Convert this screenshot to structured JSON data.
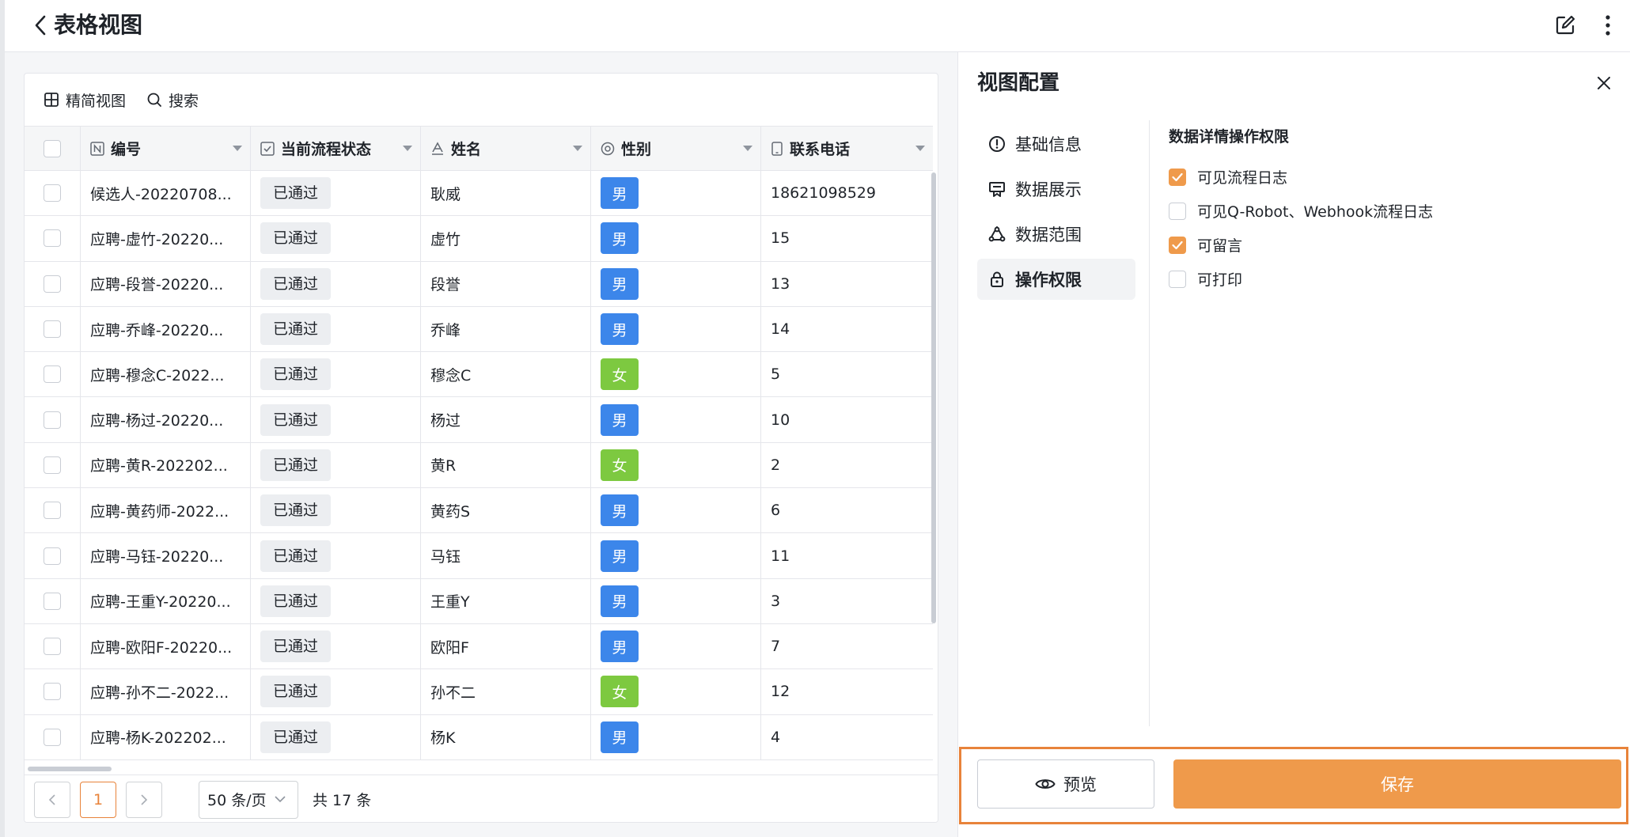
{
  "header": {
    "title": "表格视图"
  },
  "toolbar": {
    "compact_view_label": "精简视图",
    "search_label": "搜索"
  },
  "table": {
    "columns": [
      {
        "label": "编号",
        "icon": "number-field-icon"
      },
      {
        "label": "当前流程状态",
        "icon": "checkbox-field-icon"
      },
      {
        "label": "姓名",
        "icon": "text-field-icon"
      },
      {
        "label": "性别",
        "icon": "radio-field-icon"
      },
      {
        "label": "联系电话",
        "icon": "phone-field-icon"
      }
    ],
    "rows": [
      {
        "num": "候选人-20220708...",
        "status": "已通过",
        "name": "耿威",
        "sex": "男",
        "phone": "18621098529"
      },
      {
        "num": "应聘-虚竹-20220...",
        "status": "已通过",
        "name": "虚竹",
        "sex": "男",
        "phone": "15"
      },
      {
        "num": "应聘-段誉-20220...",
        "status": "已通过",
        "name": "段誉",
        "sex": "男",
        "phone": "13"
      },
      {
        "num": "应聘-乔峰-20220...",
        "status": "已通过",
        "name": "乔峰",
        "sex": "男",
        "phone": "14"
      },
      {
        "num": "应聘-穆念C-2022...",
        "status": "已通过",
        "name": "穆念C",
        "sex": "女",
        "phone": "5"
      },
      {
        "num": "应聘-杨过-20220...",
        "status": "已通过",
        "name": "杨过",
        "sex": "男",
        "phone": "10"
      },
      {
        "num": "应聘-黄R-202202...",
        "status": "已通过",
        "name": "黄R",
        "sex": "女",
        "phone": "2"
      },
      {
        "num": "应聘-黄药师-2022...",
        "status": "已通过",
        "name": "黄药S",
        "sex": "男",
        "phone": "6"
      },
      {
        "num": "应聘-马钰-20220...",
        "status": "已通过",
        "name": "马钰",
        "sex": "男",
        "phone": "11"
      },
      {
        "num": "应聘-王重Y-20220...",
        "status": "已通过",
        "name": "王重Y",
        "sex": "男",
        "phone": "3"
      },
      {
        "num": "应聘-欧阳F-20220...",
        "status": "已通过",
        "name": "欧阳F",
        "sex": "男",
        "phone": "7"
      },
      {
        "num": "应聘-孙不二-2022...",
        "status": "已通过",
        "name": "孙不二",
        "sex": "女",
        "phone": "12"
      },
      {
        "num": "应聘-杨K-202202...",
        "status": "已通过",
        "name": "杨K",
        "sex": "男",
        "phone": "4"
      }
    ],
    "sex_colors": {
      "男": "#3c86ea",
      "女": "#7dc940"
    }
  },
  "pager": {
    "current_page": "1",
    "page_size": "50 条/页",
    "total": "共 17 条"
  },
  "panel": {
    "title": "视图配置",
    "menu": [
      {
        "label": "基础信息",
        "icon": "info-icon",
        "active": false
      },
      {
        "label": "数据展示",
        "icon": "display-icon",
        "active": false
      },
      {
        "label": "数据范围",
        "icon": "scope-icon",
        "active": false
      },
      {
        "label": "操作权限",
        "icon": "lock-icon",
        "active": true
      }
    ],
    "section_title": "数据详情操作权限",
    "permissions": [
      {
        "label": "可见流程日志",
        "checked": true
      },
      {
        "label": "可见Q-Robot、Webhook流程日志",
        "checked": false
      },
      {
        "label": "可留言",
        "checked": true
      },
      {
        "label": "可打印",
        "checked": false
      }
    ],
    "preview_label": "预览",
    "save_label": "保存"
  },
  "colors": {
    "accent": "#ef9a4b",
    "highlight_border": "#e8833a"
  }
}
